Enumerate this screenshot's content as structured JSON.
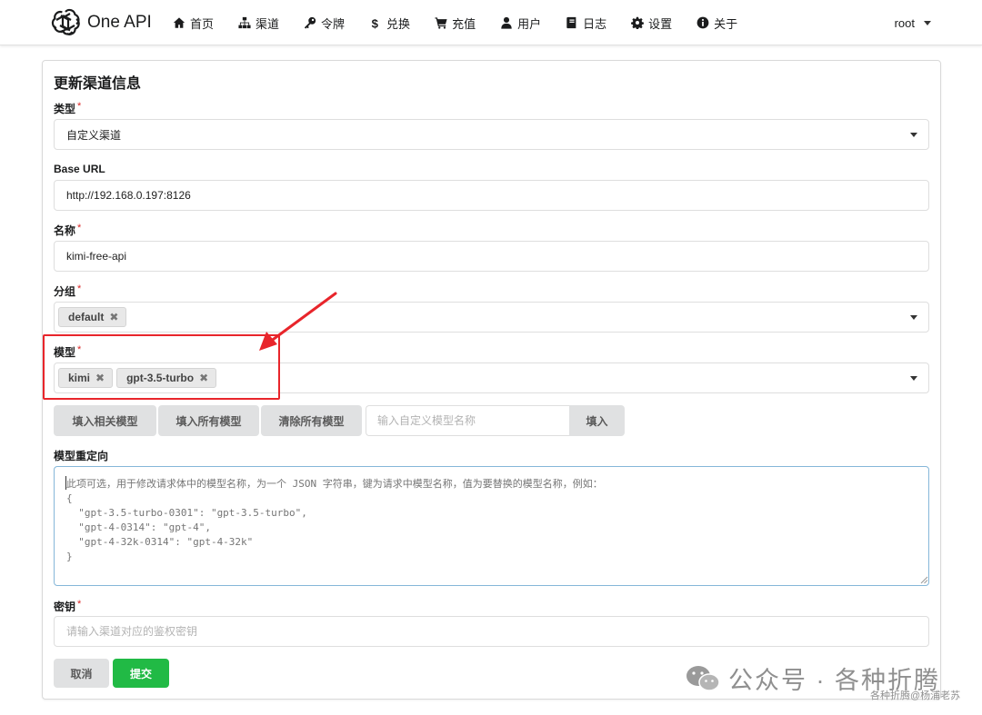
{
  "app": {
    "title": "One API"
  },
  "nav": {
    "items": [
      {
        "label": "首页",
        "icon": "home-icon"
      },
      {
        "label": "渠道",
        "icon": "sitemap-icon"
      },
      {
        "label": "令牌",
        "icon": "key-icon"
      },
      {
        "label": "兑换",
        "icon": "dollar-icon"
      },
      {
        "label": "充值",
        "icon": "cart-icon"
      },
      {
        "label": "用户",
        "icon": "user-icon"
      },
      {
        "label": "日志",
        "icon": "book-icon"
      },
      {
        "label": "设置",
        "icon": "gear-icon"
      },
      {
        "label": "关于",
        "icon": "info-icon"
      }
    ],
    "user": "root"
  },
  "form": {
    "title": "更新渠道信息",
    "required_mark": "*",
    "type": {
      "label": "类型",
      "value": "自定义渠道"
    },
    "base_url": {
      "label": "Base URL",
      "value": "http://192.168.0.197:8126"
    },
    "name": {
      "label": "名称",
      "value": "kimi-free-api"
    },
    "group": {
      "label": "分组",
      "chips": [
        "default"
      ]
    },
    "models": {
      "label": "模型",
      "chips": [
        "kimi",
        "gpt-3.5-turbo"
      ]
    },
    "model_buttons": {
      "fill_related": "填入相关模型",
      "fill_all": "填入所有模型",
      "clear_all": "清除所有模型",
      "custom_placeholder": "输入自定义模型名称",
      "fill": "填入"
    },
    "model_mapping": {
      "label": "模型重定向",
      "placeholder": "此项可选，用于修改请求体中的模型名称，为一个 JSON 字符串，键为请求中模型名称，值为要替换的模型名称，例如：\n{\n  \"gpt-3.5-turbo-0301\": \"gpt-3.5-turbo\",\n  \"gpt-4-0314\": \"gpt-4\",\n  \"gpt-4-32k-0314\": \"gpt-4-32k\"\n}"
    },
    "key": {
      "label": "密钥",
      "placeholder": "请输入渠道对应的鉴权密钥"
    },
    "cancel": "取消",
    "submit": "提交"
  },
  "colors": {
    "submit": "#21ba45",
    "required": "#db2828",
    "highlight": "#e8252b"
  },
  "watermark": {
    "text": "公众号 · 各种折腾",
    "sub": "各种折腾@杨浦老苏"
  }
}
